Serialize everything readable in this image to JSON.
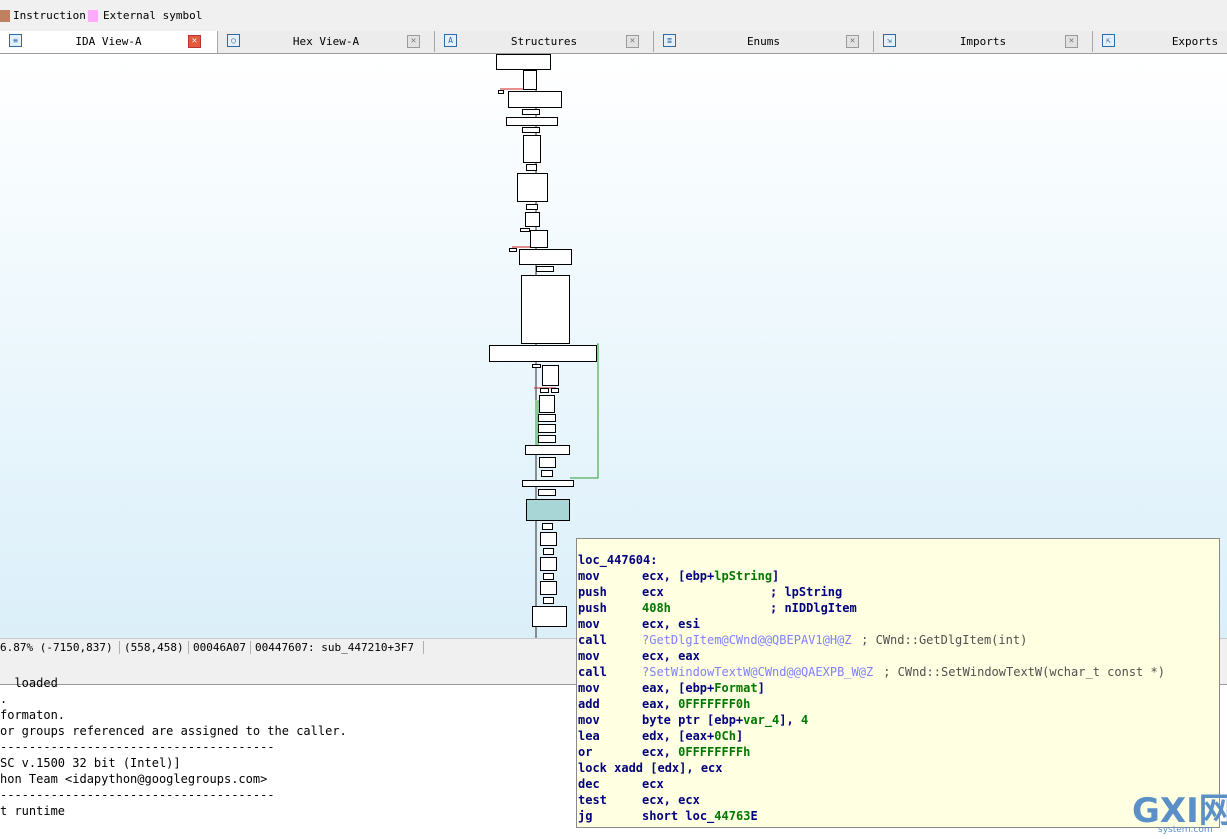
{
  "legend": {
    "items": [
      {
        "label": "Instruction",
        "color": "#c08060"
      },
      {
        "label": "External symbol",
        "color": "#ffaaff"
      }
    ]
  },
  "tabs": [
    {
      "label": "IDA View-A",
      "icon": "ida-view-icon",
      "active": true
    },
    {
      "label": "Hex View-A",
      "icon": "hex-view-icon",
      "active": false
    },
    {
      "label": "Structures",
      "icon": "structures-icon",
      "active": false
    },
    {
      "label": "Enums",
      "icon": "enums-icon",
      "active": false
    },
    {
      "label": "Imports",
      "icon": "imports-icon",
      "active": false
    },
    {
      "label": "Exports",
      "icon": "exports-icon",
      "active": false
    }
  ],
  "status": {
    "zoom": "6.87% (-7150,837)",
    "mouse": "(558,458)",
    "file_offset": "00046A07",
    "location": "00447607: sub_447210+3F7"
  },
  "output_lines": [
    "  loaded",
    ".",
    "formaton.",
    "or groups referenced are assigned to the caller.",
    "--------------------------------------",
    "SC v.1500 32 bit (Intel)]",
    "hon Team <idapython@googlegroups.com>",
    "--------------------------------------",
    "t runtime"
  ],
  "hint": {
    "label": "loc_447604:",
    "instructions": [
      {
        "mnemonic": "mov",
        "operands": "ecx, [ebp+lpString]",
        "comment": ""
      },
      {
        "mnemonic": "push",
        "operands": "ecx",
        "comment": "; lpString"
      },
      {
        "mnemonic": "push",
        "operands": "408h",
        "comment": "; nIDDlgItem"
      },
      {
        "mnemonic": "mov",
        "operands": "ecx, esi",
        "comment": ""
      },
      {
        "mnemonic": "call",
        "operands": "?GetDlgItem@CWnd@@QBEPAV1@H@Z",
        "comment": "; CWnd::GetDlgItem(int)"
      },
      {
        "mnemonic": "mov",
        "operands": "ecx, eax",
        "comment": ""
      },
      {
        "mnemonic": "call",
        "operands": "?SetWindowTextW@CWnd@@QAEXPB_W@Z",
        "comment": "; CWnd::SetWindowTextW(wchar_t const *)"
      },
      {
        "mnemonic": "mov",
        "operands": "eax, [ebp+Format]",
        "comment": ""
      },
      {
        "mnemonic": "add",
        "operands": "eax, 0FFFFFFF0h",
        "comment": ""
      },
      {
        "mnemonic": "mov",
        "operands": "byte ptr [ebp+var_4], 4",
        "comment": ""
      },
      {
        "mnemonic": "lea",
        "operands": "edx, [eax+0Ch]",
        "comment": ""
      },
      {
        "mnemonic": "or",
        "operands": "ecx, 0FFFFFFFFh",
        "comment": ""
      },
      {
        "mnemonic": "lock xadd [edx], ecx",
        "operands": "",
        "comment": ""
      },
      {
        "mnemonic": "dec",
        "operands": "ecx",
        "comment": ""
      },
      {
        "mnemonic": "test",
        "operands": "ecx, ecx",
        "comment": ""
      },
      {
        "mnemonic": "jg",
        "operands": "short loc_44763E",
        "comment": ""
      }
    ]
  },
  "watermark": {
    "brand": "GXI网",
    "domain": "system.com"
  },
  "colors": {
    "mnemonic": "#000080",
    "operand": "#000080",
    "number": "#007800",
    "symbol": "#8080ff",
    "comment": "#505050",
    "flow_true": "#2e9c2e",
    "flow_false": "#d02020"
  }
}
